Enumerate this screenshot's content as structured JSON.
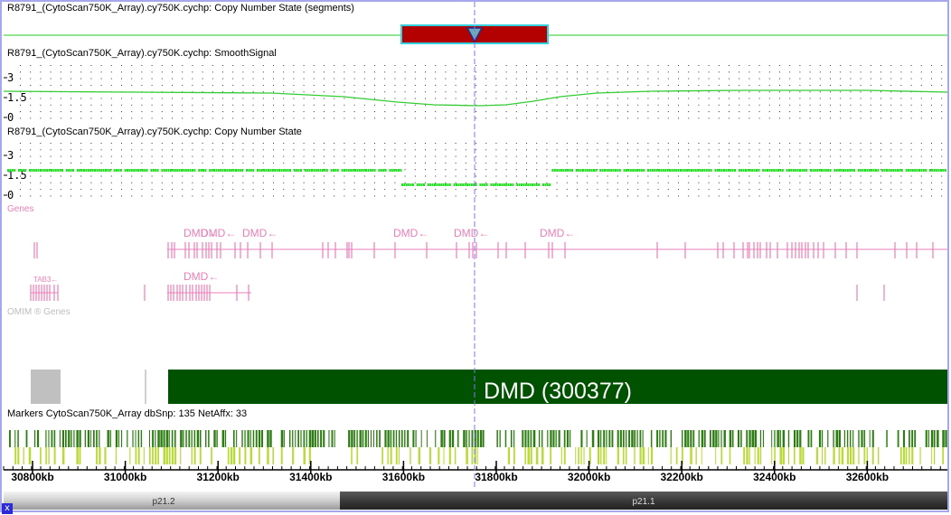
{
  "tracks": {
    "segments_label": "R8791_(CytoScan750K_Array).cy750K.cychp: Copy Number State (segments)",
    "smooth_label": "R8791_(CytoScan750K_Array).cy750K.cychp: SmoothSignal",
    "cn_state_label": "R8791_(CytoScan750K_Array).cy750K.cychp: Copy Number State",
    "genes_label": "Genes",
    "omim_label": "OMIM ® Genes",
    "markers_label": "Markers CytoScan750K_Array dbSnp: 135 NetAffx: 33"
  },
  "y_axis": {
    "smooth_ticks": [
      "3",
      "1.5",
      "0"
    ],
    "cn_ticks": [
      "3",
      "1.5",
      "0"
    ]
  },
  "genes": {
    "labels_row1": [
      "DMD←",
      "DMD←",
      "DMD←",
      "DMD←",
      "DMD←",
      "DMD←"
    ],
    "labels_row2_left": "TAB3←",
    "labels_row2_dmd": "DMD←"
  },
  "omim": {
    "gene_title": "DMD (300377)"
  },
  "axis": {
    "ticks": [
      "30800kb",
      "31000kb",
      "31200kb",
      "31400kb",
      "31600kb",
      "31800kb",
      "32000kb",
      "32200kb",
      "32400kb",
      "32600kb"
    ]
  },
  "ideogram": {
    "band_left": "p21.2",
    "band_right": "p21.1"
  },
  "close_button": "x",
  "colors": {
    "frame": "#a7a7ee",
    "segment_line": "#22cc22",
    "segment_box": "#b30000",
    "segment_box_border": "#35d0e0",
    "smooth_line": "#33cc33",
    "cn_state": "#22dd22",
    "gene": "#e87fb8",
    "omim_bar": "#005200",
    "omim_grey": "#c0c0c0",
    "marker_dark": "#2e7d13",
    "marker_light": "#bada3a",
    "cursor": "#7b7be8",
    "band_left": "#cccccc",
    "band_right": "#3a3a3a"
  }
}
